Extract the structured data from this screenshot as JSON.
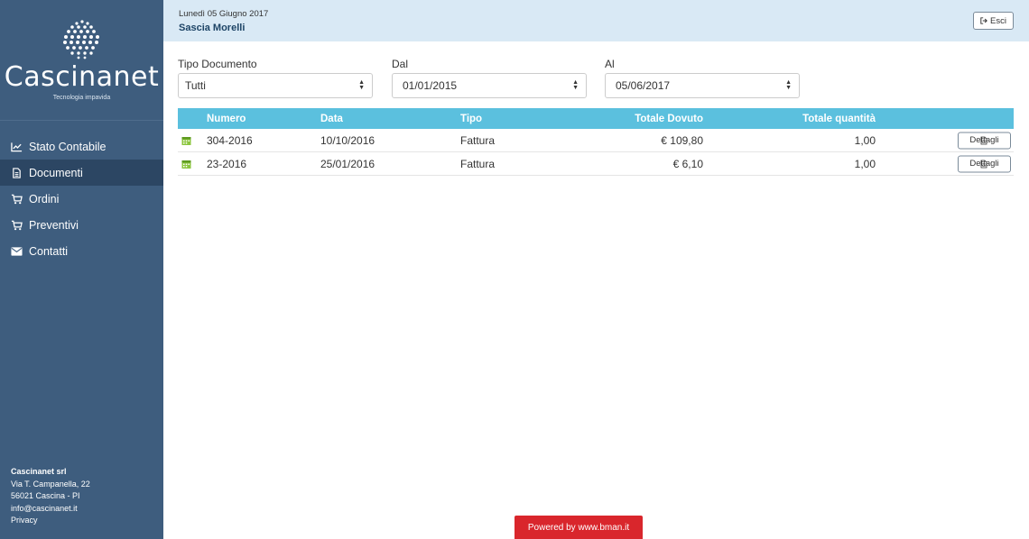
{
  "sidebar": {
    "logo": {
      "name": "Cascinanet",
      "tagline": "Tecnologia impavida"
    },
    "items": [
      {
        "label": "Stato Contabile",
        "icon": "line-chart-icon",
        "active": false
      },
      {
        "label": "Documenti",
        "icon": "document-icon",
        "active": true
      },
      {
        "label": "Ordini",
        "icon": "cart-icon",
        "active": false
      },
      {
        "label": "Preventivi",
        "icon": "cart-icon",
        "active": false
      },
      {
        "label": "Contatti",
        "icon": "envelope-icon",
        "active": false
      }
    ],
    "footer": {
      "company": "Cascinanet srl",
      "street": "Via T. Campanella, 22",
      "city": "56021 Cascina - PI",
      "email": "info@cascinanet.it",
      "privacy": "Privacy"
    }
  },
  "header": {
    "date": "Lunedì 05 Giugno 2017",
    "user": "Sascia Morelli",
    "exit_label": "Esci"
  },
  "filters": {
    "tipo": {
      "label": "Tipo Documento",
      "value": "Tutti"
    },
    "dal": {
      "label": "Dal",
      "value": "01/01/2015"
    },
    "al": {
      "label": "Al",
      "value": "05/06/2017"
    }
  },
  "table": {
    "columns": [
      "Numero",
      "Data",
      "Tipo",
      "Totale Dovuto",
      "Totale quantità"
    ],
    "rows": [
      {
        "numero": "304-2016",
        "data": "10/10/2016",
        "tipo": "Fattura",
        "totale": "€ 109,80",
        "quantita": "1,00",
        "action": "Dettagli"
      },
      {
        "numero": "23-2016",
        "data": "25/01/2016",
        "tipo": "Fattura",
        "totale": "€ 6,10",
        "quantita": "1,00",
        "action": "Dettagli"
      }
    ]
  },
  "footer": {
    "powered": "Powered by www.bman.it"
  },
  "colors": {
    "sidebar": "#3e5d7e",
    "sidebar_active": "#2c4663",
    "header": "#d9e9f5",
    "table_head": "#5bc0de",
    "powered": "#d9262c"
  }
}
